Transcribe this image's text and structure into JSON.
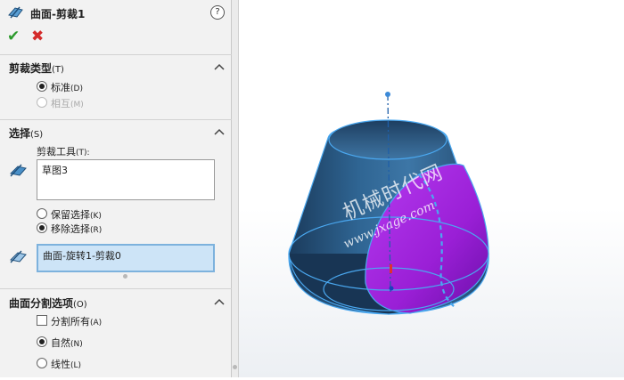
{
  "feature": {
    "title": "曲面-剪裁1",
    "help_icon": "?",
    "ok_icon": "✔",
    "cancel_icon": "✖"
  },
  "trim_type": {
    "header": "剪裁类型",
    "header_shortcut": "(T)",
    "options": [
      {
        "label": "标准",
        "shortcut": "(D)",
        "selected": true,
        "enabled": true
      },
      {
        "label": "相互",
        "shortcut": "(M)",
        "selected": false,
        "enabled": false
      }
    ]
  },
  "selections": {
    "header": "选择",
    "header_shortcut": "(S)",
    "trim_tool_label": "剪裁工具",
    "trim_tool_shortcut": "(T):",
    "trim_tool_value": "草图3",
    "keep_remove": [
      {
        "label": "保留选择",
        "shortcut": "(K)",
        "selected": false
      },
      {
        "label": "移除选择",
        "shortcut": "(R)",
        "selected": true
      }
    ],
    "faces_value": "曲面-旋转1-剪裁0"
  },
  "split_options": {
    "header": "曲面分割选项",
    "header_shortcut": "(O)",
    "split_all": {
      "label": "分割所有",
      "shortcut": "(A)",
      "checked": false
    },
    "options": [
      {
        "label": "自然",
        "shortcut": "(N)",
        "selected": true
      },
      {
        "label": "线性",
        "shortcut": "(L)",
        "selected": false
      }
    ]
  },
  "watermark": {
    "line1": "机械时代网",
    "line2": "www.jxage.com"
  },
  "colors": {
    "surface_blue": "#2a5a86",
    "selection_purple": "#a020d8",
    "edge_highlight": "#4aa8f0",
    "accent_ok": "#2c9a2c",
    "accent_cancel": "#d42b2b"
  }
}
